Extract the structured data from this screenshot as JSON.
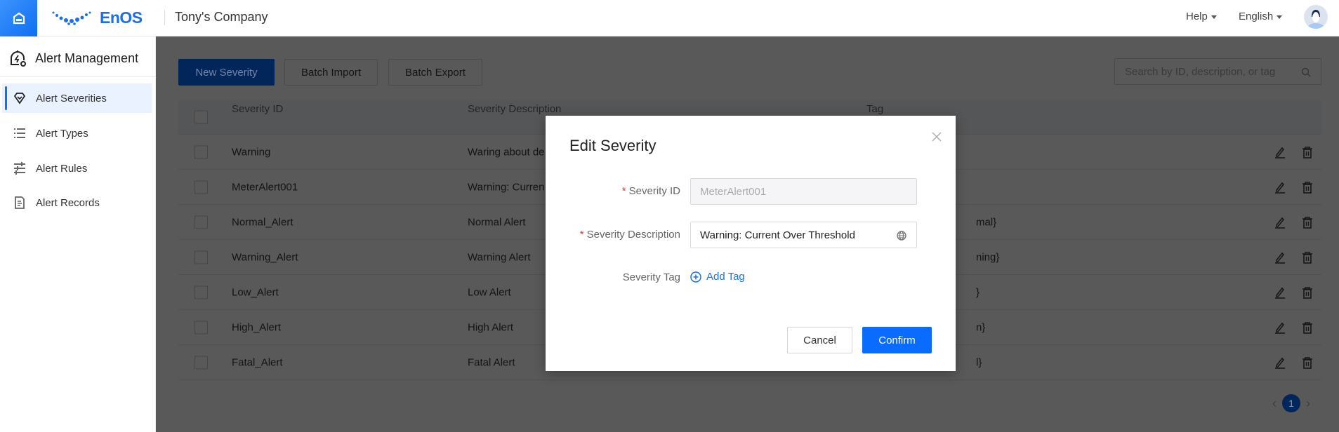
{
  "header": {
    "brand": "EnOS",
    "company": "Tony's Company",
    "help": "Help",
    "language": "English"
  },
  "sidebar": {
    "title": "Alert Management",
    "items": [
      {
        "label": "Alert Severities",
        "icon": "diamond-icon",
        "active": true
      },
      {
        "label": "Alert Types",
        "icon": "list-icon"
      },
      {
        "label": "Alert Rules",
        "icon": "sliders-icon"
      },
      {
        "label": "Alert Records",
        "icon": "document-icon"
      }
    ]
  },
  "toolbar": {
    "new": "New Severity",
    "import": "Batch Import",
    "export": "Batch Export",
    "search_placeholder": "Search by ID, description, or tag"
  },
  "table": {
    "headers": [
      "Severity ID",
      "Severity Description",
      "Tag"
    ],
    "rows": [
      {
        "id": "Warning",
        "desc": "Waring about de",
        "tag": ""
      },
      {
        "id": "MeterAlert001",
        "desc": "Warning: Curren",
        "tag": ""
      },
      {
        "id": "Normal_Alert",
        "desc": "Normal Alert",
        "tag": "mal}"
      },
      {
        "id": "Warning_Alert",
        "desc": "Warning Alert",
        "tag": "ning}"
      },
      {
        "id": "Low_Alert",
        "desc": "Low Alert",
        "tag": "}"
      },
      {
        "id": "High_Alert",
        "desc": "High Alert",
        "tag": "n}"
      },
      {
        "id": "Fatal_Alert",
        "desc": "Fatal Alert",
        "tag": "l}"
      }
    ]
  },
  "pagination": {
    "current": "1"
  },
  "dialog": {
    "title": "Edit Severity",
    "id_label": "Severity ID",
    "id_value": "MeterAlert001",
    "desc_label": "Severity Description",
    "desc_value": "Warning: Current Over Threshold",
    "tag_label": "Severity Tag",
    "add_tag": "Add Tag",
    "cancel": "Cancel",
    "confirm": "Confirm",
    "required_mark": "*"
  },
  "colors": {
    "accent": "#0a6cff",
    "overlay": "rgba(0,0,0,0.65)"
  }
}
